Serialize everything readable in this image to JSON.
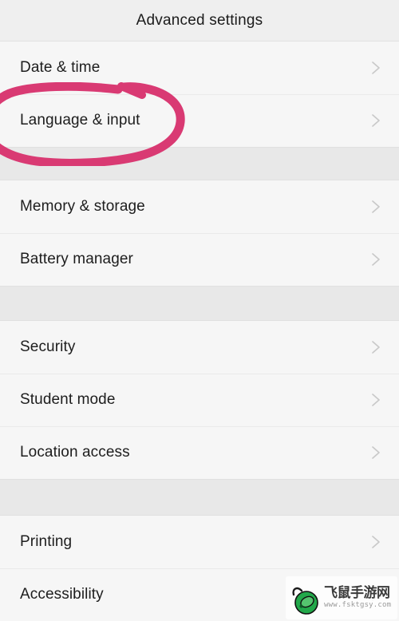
{
  "header": {
    "title": "Advanced settings"
  },
  "list": {
    "groups": [
      {
        "rows": [
          {
            "label": "Date & time",
            "chevron": "chevron-right-icon",
            "highlighted": false
          },
          {
            "label": "Language & input",
            "chevron": "chevron-right-icon",
            "highlighted": true
          }
        ]
      },
      {
        "rows": [
          {
            "label": "Memory & storage",
            "chevron": "chevron-right-icon",
            "highlighted": false
          },
          {
            "label": "Battery manager",
            "chevron": "chevron-right-icon",
            "highlighted": false
          }
        ]
      },
      {
        "rows": [
          {
            "label": "Security",
            "chevron": "chevron-right-icon",
            "highlighted": false
          },
          {
            "label": "Student mode",
            "chevron": "chevron-right-icon",
            "highlighted": false
          },
          {
            "label": "Location access",
            "chevron": "chevron-right-icon",
            "highlighted": false
          }
        ]
      },
      {
        "rows": [
          {
            "label": "Printing",
            "chevron": "chevron-right-icon",
            "highlighted": false
          },
          {
            "label": "Accessibility",
            "chevron": "chevron-right-icon",
            "highlighted": false
          }
        ]
      }
    ]
  },
  "annotation": {
    "type": "hand-drawn-ellipse",
    "target": "Language & input",
    "color": "#d93a73"
  },
  "watermark": {
    "site_name": "飞鼠手游网",
    "url": "www.fsktgsy.com",
    "logo": "green-mouse-icon",
    "logo_color": "#22a84a"
  },
  "colors": {
    "header_bg": "#efefef",
    "row_bg": "#f6f6f6",
    "band_bg": "#e8e8e8",
    "divider": "#eaeaea",
    "text": "#1d1d1d",
    "chevron": "#c9c9c9",
    "annotation_pink": "#d93a73"
  }
}
